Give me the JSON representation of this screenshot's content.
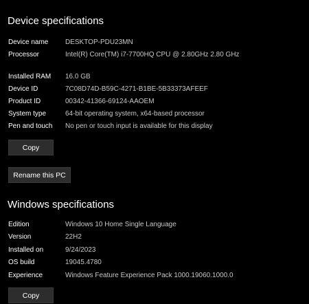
{
  "device_specs": {
    "title": "Device specifications",
    "rows": [
      {
        "label": "Device name",
        "value": "DESKTOP-PDU23MN"
      },
      {
        "label": "Processor",
        "value": "Intel(R) Core(TM) i7-7700HQ CPU @ 2.80GHz   2.80 GHz"
      },
      {
        "label": "Installed RAM",
        "value": "16.0 GB"
      },
      {
        "label": "Device ID",
        "value": "7C08D74D-B59C-4271-B1BE-5B33373AFEEF"
      },
      {
        "label": "Product ID",
        "value": "00342-41366-69124-AAOEM"
      },
      {
        "label": "System type",
        "value": "64-bit operating system, x64-based processor"
      },
      {
        "label": "Pen and touch",
        "value": "No pen or touch input is available for this display"
      }
    ],
    "copy_label": "Copy",
    "rename_label": "Rename this PC"
  },
  "windows_specs": {
    "title": "Windows specifications",
    "rows": [
      {
        "label": "Edition",
        "value": "Windows 10 Home Single Language"
      },
      {
        "label": "Version",
        "value": "22H2"
      },
      {
        "label": "Installed on",
        "value": "9/24/2023"
      },
      {
        "label": "OS build",
        "value": "19045.4780"
      },
      {
        "label": "Experience",
        "value": "Windows Feature Experience Pack 1000.19060.1000.0"
      }
    ],
    "copy_label": "Copy"
  }
}
